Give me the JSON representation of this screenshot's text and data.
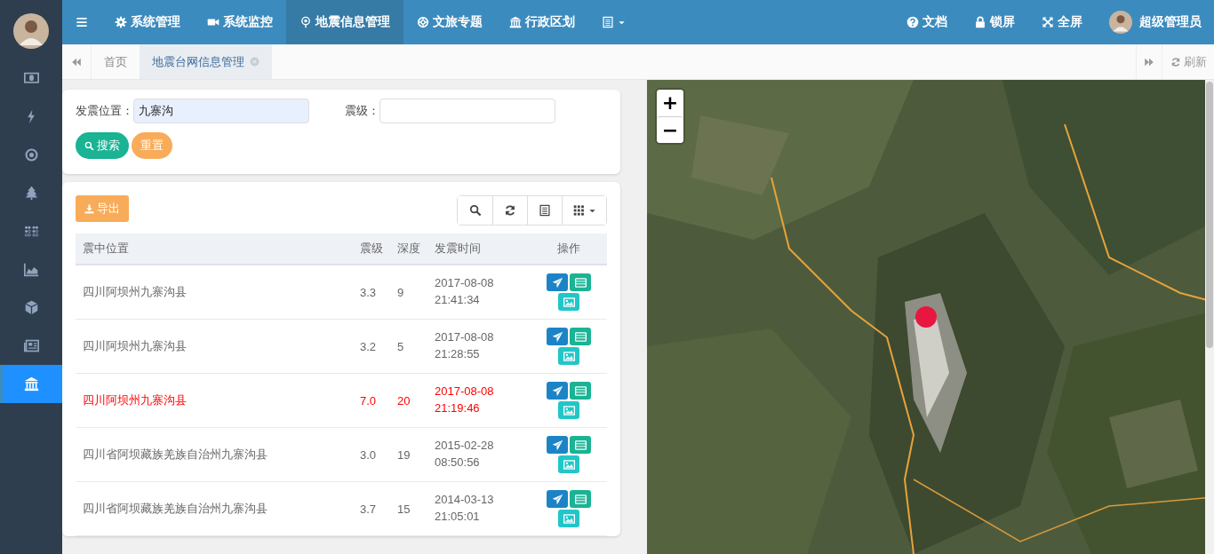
{
  "sidebar": {
    "items": [
      {
        "kind": "money",
        "selected": false
      },
      {
        "kind": "bolt",
        "selected": false
      },
      {
        "kind": "target",
        "selected": false
      },
      {
        "kind": "tree",
        "selected": false
      },
      {
        "kind": "dots",
        "selected": false
      },
      {
        "kind": "chart",
        "selected": false
      },
      {
        "kind": "cube",
        "selected": false
      },
      {
        "kind": "news",
        "selected": false
      },
      {
        "kind": "bank",
        "selected": true
      }
    ]
  },
  "top_nav": {
    "items": [
      {
        "kind": "gear",
        "label": "系统管理",
        "selected": false
      },
      {
        "kind": "video",
        "label": "系统监控",
        "selected": false
      },
      {
        "kind": "pin",
        "label": "地震信息管理",
        "selected": true
      },
      {
        "kind": "ring",
        "label": "文旅专题",
        "selected": false
      },
      {
        "kind": "bank",
        "label": "行政区划",
        "selected": false
      },
      {
        "kind": "more",
        "selected": false
      }
    ],
    "right_items": [
      {
        "kind": "help",
        "label": "文档"
      },
      {
        "kind": "lock",
        "label": "锁屏"
      },
      {
        "kind": "expand",
        "label": "全屏"
      }
    ],
    "user": {
      "name": "超级管理员"
    }
  },
  "tabs": [
    {
      "label": "首页",
      "selected": false,
      "closable": false
    },
    {
      "label": "地震台网信息管理",
      "selected": true,
      "closable": true
    }
  ],
  "refresh": {
    "label": "刷新"
  },
  "search_form": {
    "fields": [
      {
        "label": "发震位置：",
        "value": "九寨沟",
        "autofilled": true
      },
      {
        "label": "震级：",
        "autofilled": false
      }
    ],
    "buttons": [
      {
        "kind": "search",
        "label": "搜索"
      },
      {
        "kind": "reset",
        "label": "重置"
      }
    ]
  },
  "table": {
    "export": {
      "label": "导出"
    },
    "toolbar": [
      {
        "kind": "search"
      },
      {
        "kind": "refresh"
      },
      {
        "kind": "list"
      },
      {
        "kind": "columns"
      }
    ],
    "columns": [
      "震中位置",
      "震级",
      "深度",
      "发震时间",
      "操作"
    ],
    "rows": [
      {
        "location": "四川阿坝州九寨沟县",
        "magnitude": "3.3",
        "depth": "9",
        "date": "2017-08-08",
        "time": "21:41:34",
        "highlighted": false
      },
      {
        "location": "四川阿坝州九寨沟县",
        "magnitude": "3.2",
        "depth": "5",
        "date": "2017-08-08",
        "time": "21:28:55",
        "highlighted": false
      },
      {
        "location": "四川阿坝州九寨沟县",
        "magnitude": "7.0",
        "depth": "20",
        "date": "2017-08-08",
        "time": "21:19:46",
        "highlighted": true
      },
      {
        "location": "四川省阿坝藏族羌族自治州九寨沟县",
        "magnitude": "3.0",
        "depth": "19",
        "date": "2015-02-28",
        "time": "08:50:56",
        "highlighted": false
      },
      {
        "location": "四川省阿坝藏族羌族自治州九寨沟县",
        "magnitude": "3.7",
        "depth": "15",
        "date": "2014-03-13",
        "time": "21:05:01",
        "highlighted": false
      }
    ]
  },
  "map": {
    "kind": "picture",
    "zoom_in": "+",
    "zoom_out": "−"
  }
}
